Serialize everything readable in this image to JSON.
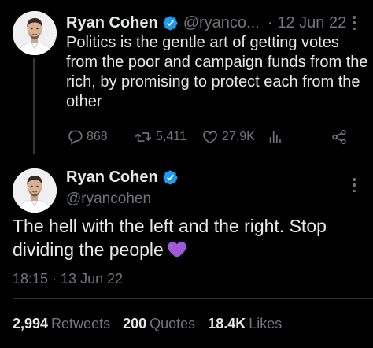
{
  "parent_tweet": {
    "author_name": "Ryan Cohen",
    "handle": "@ryanco...",
    "separator": "·",
    "date": "12 Jun 22",
    "text": "Politics is the gentle art of getting votes from the poor and campaign funds from the rich, by promising to protect each from the other",
    "actions": {
      "replies": "868",
      "retweets": "5,411",
      "likes": "27.9K"
    },
    "icons": [
      "verified-badge-icon",
      "more-icon",
      "reply-icon",
      "retweet-icon",
      "like-icon",
      "views-icon",
      "share-icon"
    ]
  },
  "main_tweet": {
    "author_name": "Ryan Cohen",
    "handle": "@ryancohen",
    "text": "The hell with the left and the right. Stop dividing the people",
    "emoji": "purple-heart",
    "timestamp": "18:15 · 13 Jun 22",
    "stats": {
      "retweets_count": "2,994",
      "retweets_label": "Retweets",
      "quotes_count": "200",
      "quotes_label": "Quotes",
      "likes_count": "18.4K",
      "likes_label": "Likes"
    }
  },
  "colors": {
    "background": "#000000",
    "primary_text": "#e7e9ea",
    "secondary_text": "#71767b",
    "verified_blue": "#1d9bf0",
    "divider": "#2f3336",
    "emoji_purple": "#a259d9"
  }
}
